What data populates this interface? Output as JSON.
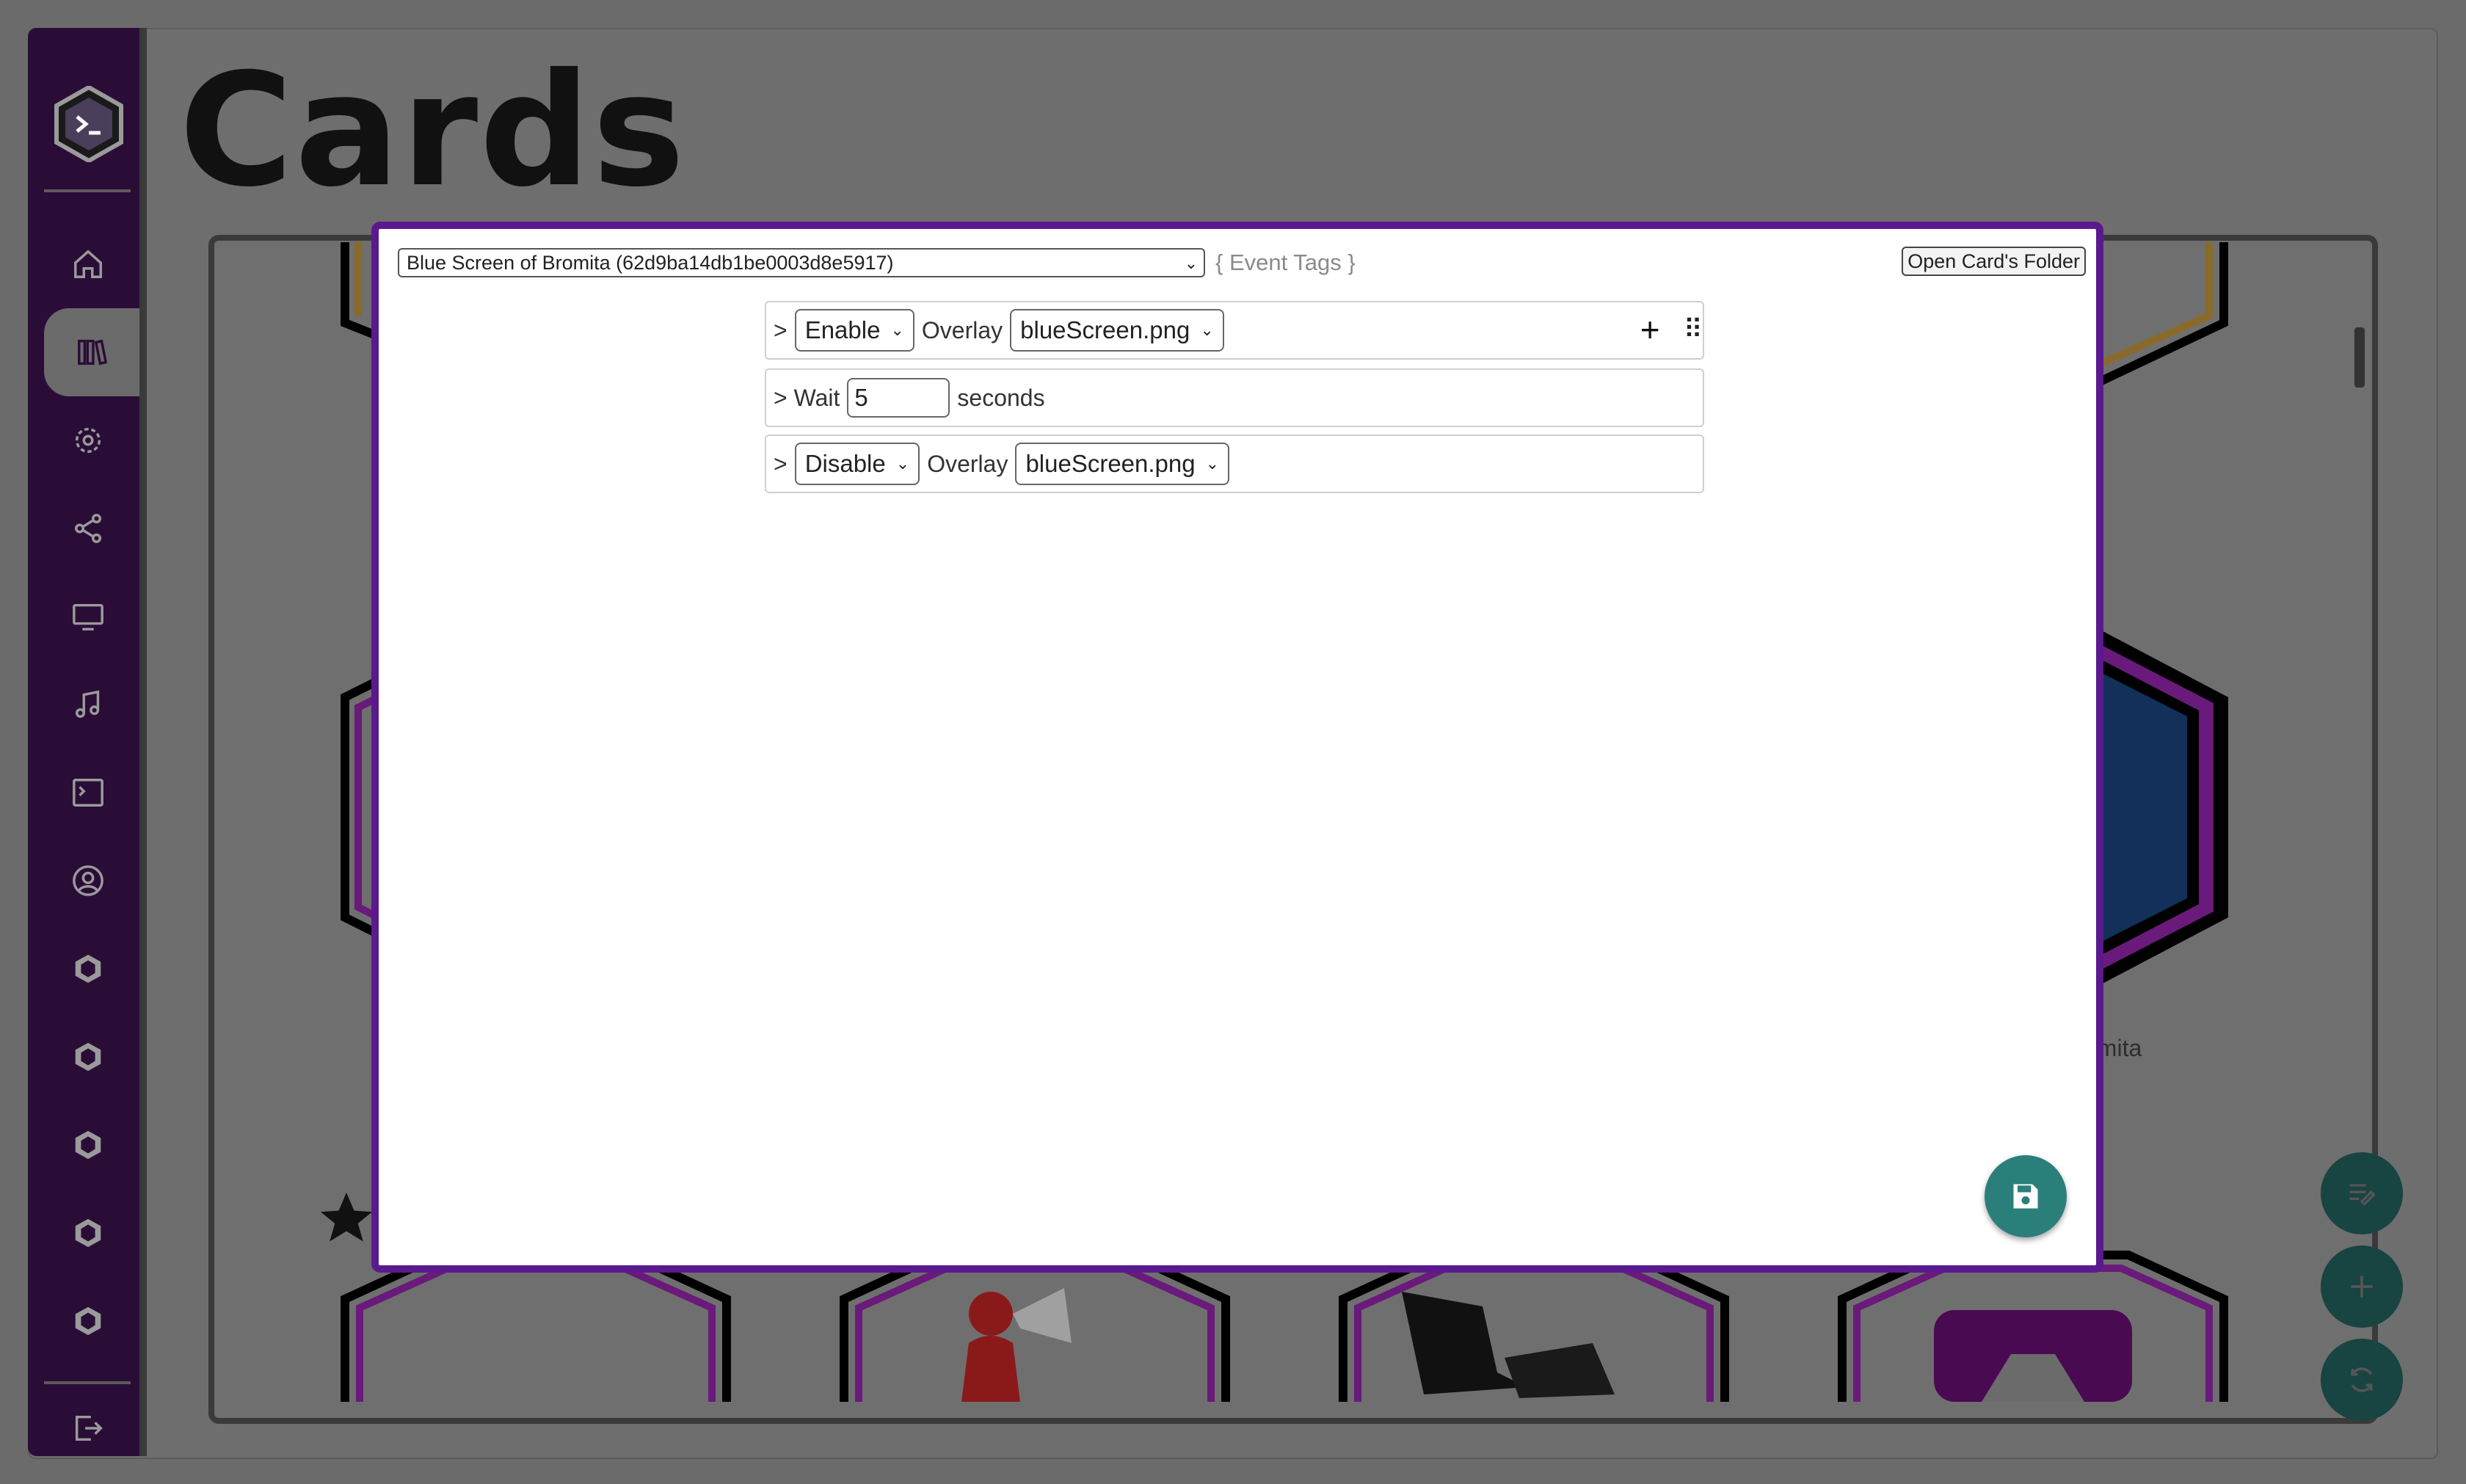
{
  "page": {
    "title": "Cards"
  },
  "sidebar": {
    "items": [
      {
        "icon": "home-icon"
      },
      {
        "icon": "library-icon",
        "active": true
      },
      {
        "icon": "gear-icon"
      },
      {
        "icon": "share-icon"
      },
      {
        "icon": "monitor-icon"
      },
      {
        "icon": "music-icon"
      },
      {
        "icon": "terminal-icon"
      },
      {
        "icon": "user-icon"
      },
      {
        "icon": "hex-badge-icon"
      },
      {
        "icon": "hex-badge-icon"
      },
      {
        "icon": "hex-badge-icon"
      },
      {
        "icon": "hex-badge-icon"
      },
      {
        "icon": "hex-badge-icon"
      },
      {
        "icon": "logout-icon"
      }
    ]
  },
  "background": {
    "partial_card_label": "omita"
  },
  "modal": {
    "card_select_value": "Blue Screen of Bromita (62d9ba14db1be0003d8e5917)",
    "event_tags": "{ Event Tags }",
    "open_folder_label": "Open Card's Folder",
    "rows": [
      {
        "prefix": ">",
        "mode": "Enable",
        "label": "Overlay",
        "overlay": "blueScreen.png"
      },
      {
        "prefix": "> Wait",
        "value": "5",
        "suffix": "seconds"
      },
      {
        "prefix": ">",
        "mode": "Disable",
        "label": "Overlay",
        "overlay": "blueScreen.png"
      }
    ],
    "add_symbol": "+",
    "grip_symbol": "⠿"
  },
  "colors": {
    "sidebar_bg": "#2a0d37",
    "modal_border": "#5a1a8e",
    "save_fab": "#2b7f7b",
    "side_fab": "#184442"
  }
}
